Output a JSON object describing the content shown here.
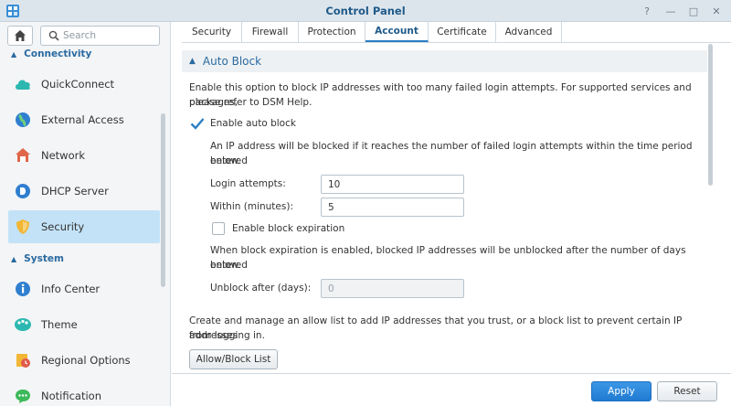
{
  "window": {
    "title": "Control Panel",
    "controls": {
      "help": "?",
      "minimize": "—",
      "maximize": "□",
      "close": "✕"
    }
  },
  "sidebar": {
    "search_placeholder": "Search",
    "groups": [
      {
        "label": "Connectivity",
        "items": [
          "QuickConnect",
          "External Access",
          "Network",
          "DHCP Server",
          "Security"
        ]
      },
      {
        "label": "System",
        "items": [
          "Info Center",
          "Theme",
          "Regional Options",
          "Notification"
        ]
      }
    ],
    "active_item": "Security"
  },
  "tabs": [
    {
      "label": "Security",
      "active": false
    },
    {
      "label": "Firewall",
      "active": false
    },
    {
      "label": "Protection",
      "active": false
    },
    {
      "label": "Account",
      "active": true
    },
    {
      "label": "Certificate",
      "active": false
    },
    {
      "label": "Advanced",
      "active": false
    }
  ],
  "auto_block": {
    "section_title": "Auto Block",
    "description_line1": "Enable this option to block IP addresses with too many failed login attempts. For supported services and packages,",
    "description_line2": "please refer to DSM Help.",
    "enable_label": "Enable auto block",
    "enable_checked": true,
    "threshold_note_line1": "An IP address will be blocked if it reaches the number of failed login attempts within the time period entered",
    "threshold_note_line2": "below.",
    "login_attempts_label": "Login attempts:",
    "login_attempts_value": "10",
    "within_label": "Within (minutes):",
    "within_value": "5",
    "expiration_label": "Enable block expiration",
    "expiration_checked": false,
    "expiration_note_line1": "When block expiration is enabled, blocked IP addresses will be unblocked after the number of days entered",
    "expiration_note_line2": "below.",
    "unblock_label": "Unblock after (days):",
    "unblock_value": "0",
    "list_note_line1": "Create and manage an allow list to add IP addresses that you trust, or a block list to prevent certain IP addresses",
    "list_note_line2": "from logging in.",
    "list_button": "Allow/Block List"
  },
  "footer": {
    "apply": "Apply",
    "reset": "Reset"
  },
  "colors": {
    "accent": "#1f7bd1",
    "active_nav": "#c3e2f7",
    "header_text": "#2a6aa0"
  }
}
